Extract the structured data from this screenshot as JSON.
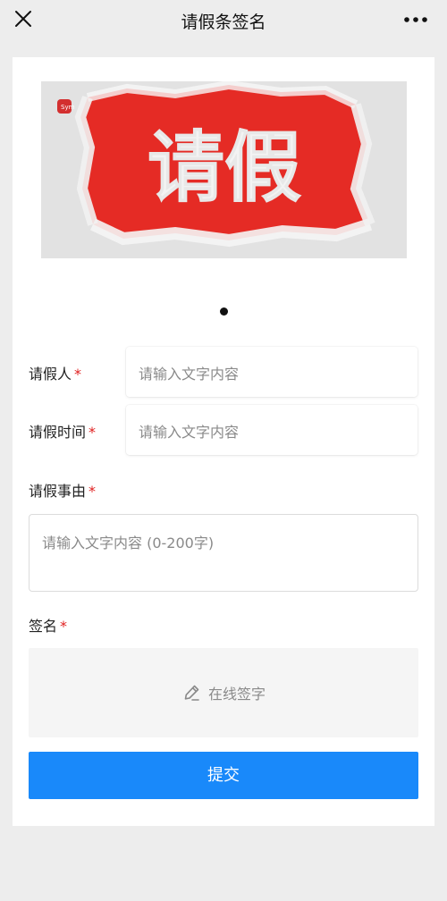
{
  "header": {
    "title": "请假条签名"
  },
  "banner": {
    "text": "请假",
    "logo_text": "Sym"
  },
  "carousel": {
    "count": 1,
    "active": 1
  },
  "form": {
    "requester": {
      "label": "请假人",
      "required_mark": "*",
      "placeholder": "请输入文字内容"
    },
    "leave_time": {
      "label": "请假时间",
      "required_mark": "*",
      "placeholder": "请输入文字内容"
    },
    "reason": {
      "label": "请假事由",
      "required_mark": "*",
      "placeholder": "请输入文字内容 (0-200字)"
    },
    "signature": {
      "label": "签名",
      "required_mark": "*",
      "button_text": "在线签字"
    },
    "submit_label": "提交"
  },
  "colors": {
    "primary": "#1989fa",
    "required": "#e02020",
    "banner_red": "#e52b25"
  }
}
